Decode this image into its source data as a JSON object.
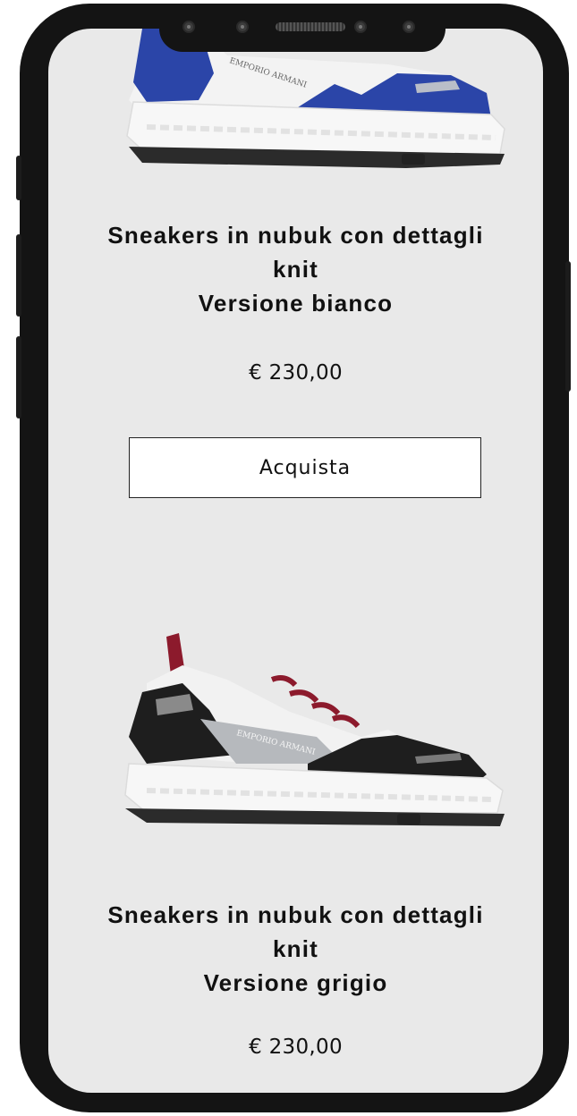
{
  "products": [
    {
      "title_line1": "Sneakers in nubuk con dettagli",
      "title_line2": "knit",
      "title_line3": "Versione bianco",
      "price": "€ 230,00",
      "buy_label": "Acquista",
      "image_icon": "sneaker-white-blue",
      "brand_print": "EMPORIO ARMANI"
    },
    {
      "title_line1": "Sneakers in nubuk con dettagli",
      "title_line2": "knit",
      "title_line3": "Versione grigio",
      "price": "€ 230,00",
      "image_icon": "sneaker-white-grey-black",
      "brand_print": "EMPORIO ARMANI"
    }
  ],
  "colors": {
    "screen_bg": "#e9e9e9",
    "frame": "#141414",
    "accent_blue": "#2b45a8",
    "accent_red": "#8c1a2c"
  }
}
